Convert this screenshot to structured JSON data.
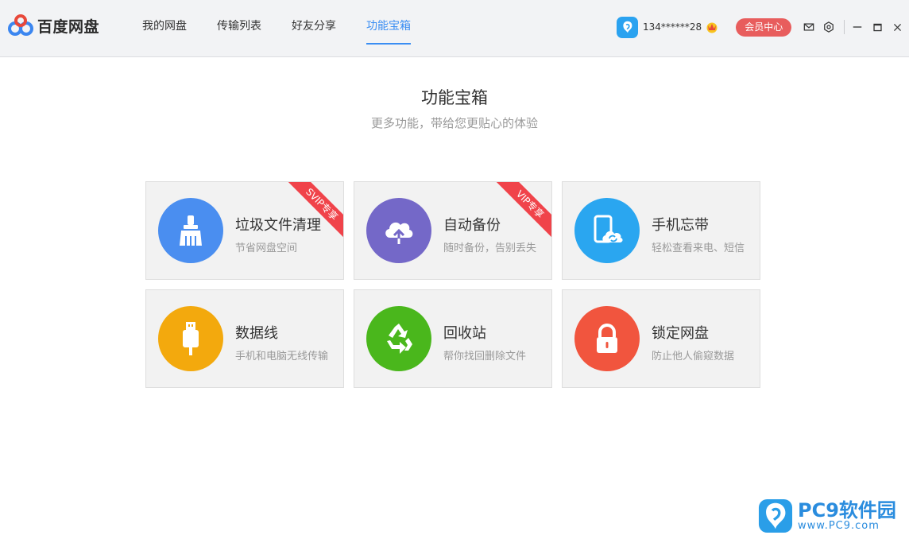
{
  "app": {
    "name": "百度网盘"
  },
  "nav": {
    "items": [
      {
        "label": "我的网盘"
      },
      {
        "label": "传输列表"
      },
      {
        "label": "好友分享"
      },
      {
        "label": "功能宝箱"
      }
    ],
    "active": 3
  },
  "user": {
    "name": "134******28",
    "member_label": "会员中心"
  },
  "page": {
    "title": "功能宝箱",
    "subtitle": "更多功能，带给您更贴心的体验"
  },
  "cards": [
    {
      "title": "垃圾文件清理",
      "desc": "节省网盘空间",
      "icon": "broom-icon",
      "color": "#4a8ef0",
      "ribbon": "SVIP专享"
    },
    {
      "title": "自动备份",
      "desc": "随时备份，告别丢失",
      "icon": "cloud-upload-icon",
      "color": "#7468c8",
      "ribbon": "VIP专享"
    },
    {
      "title": "手机忘带",
      "desc": "轻松查看来电、短信",
      "icon": "phone-sync-icon",
      "color": "#2aa6f0"
    },
    {
      "title": "数据线",
      "desc": "手机和电脑无线传输",
      "icon": "usb-cable-icon",
      "color": "#f3a90d"
    },
    {
      "title": "回收站",
      "desc": "帮你找回删除文件",
      "icon": "recycle-icon",
      "color": "#4ab71c"
    },
    {
      "title": "锁定网盘",
      "desc": "防止他人偷窥数据",
      "icon": "lock-icon",
      "color": "#f1553e"
    }
  ],
  "watermark": {
    "main": "PC9软件园",
    "sub": "www.PC9.com"
  }
}
